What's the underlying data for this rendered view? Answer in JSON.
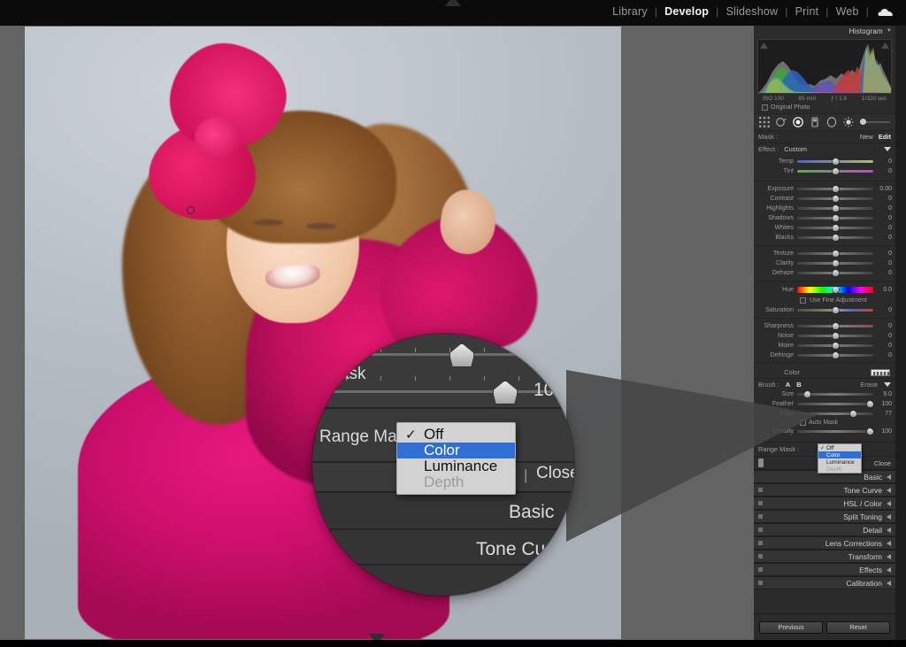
{
  "app": {
    "modules": [
      {
        "label": "Library",
        "active": false
      },
      {
        "label": "Develop",
        "active": true
      },
      {
        "label": "Slideshow",
        "active": false
      },
      {
        "label": "Print",
        "active": false
      },
      {
        "label": "Web",
        "active": false
      }
    ],
    "separator": "|",
    "cloud_icon": "cloud-icon"
  },
  "histogram": {
    "title": "Histogram",
    "iso": "ISO 100",
    "focal": "85 mm",
    "aperture": "ƒ / 1.6",
    "shutter": "1/320 sec",
    "original_photo_label": "Original Photo"
  },
  "toolstrip": {
    "icons": [
      "grid-crop-icon",
      "spot-removal-icon",
      "red-eye-icon",
      "graduated-filter-icon",
      "radial-filter-icon",
      "brush-icon"
    ],
    "brightness_icon": "brightness-icon"
  },
  "mask_bar": {
    "label": "Mask :",
    "new_label": "New",
    "edit_label": "Edit"
  },
  "effect_bar": {
    "label": "Effect :",
    "value": "Custom",
    "flip_icon": "flip-triangle-icon"
  },
  "sliders": {
    "white_balance": [
      {
        "label": "Temp",
        "value": "0",
        "pos": 50,
        "style": "temp"
      },
      {
        "label": "Tint",
        "value": "0",
        "pos": 50,
        "style": "tint"
      }
    ],
    "tone": [
      {
        "label": "Exposure",
        "value": "0.00",
        "pos": 50,
        "style": "plain"
      },
      {
        "label": "Contrast",
        "value": "0",
        "pos": 50,
        "style": "plain"
      },
      {
        "label": "Highlights",
        "value": "0",
        "pos": 50,
        "style": "plain"
      },
      {
        "label": "Shadows",
        "value": "0",
        "pos": 50,
        "style": "plain"
      },
      {
        "label": "Whites",
        "value": "0",
        "pos": 50,
        "style": "plain"
      },
      {
        "label": "Blacks",
        "value": "0",
        "pos": 50,
        "style": "plain"
      }
    ],
    "presence": [
      {
        "label": "Texture",
        "value": "0",
        "pos": 50,
        "style": "plain"
      },
      {
        "label": "Clarity",
        "value": "0",
        "pos": 50,
        "style": "plain"
      },
      {
        "label": "Dehaze",
        "value": "0",
        "pos": 50,
        "style": "plain"
      }
    ],
    "color": [
      {
        "label": "Hue",
        "value": "0.0",
        "pos": 50,
        "style": "hue"
      }
    ],
    "fine_adjustment_label": "Use Fine Adjustment",
    "saturation": [
      {
        "label": "Saturation",
        "value": "0",
        "pos": 50,
        "style": "sat"
      }
    ],
    "detail": [
      {
        "label": "Sharpness",
        "value": "0",
        "pos": 50,
        "style": "sharp"
      },
      {
        "label": "Noise",
        "value": "0",
        "pos": 50,
        "style": "plain"
      },
      {
        "label": "Moire",
        "value": "0",
        "pos": 50,
        "style": "plain"
      },
      {
        "label": "Defringe",
        "value": "0",
        "pos": 50,
        "style": "plain"
      }
    ],
    "color_row_label": "Color"
  },
  "brush": {
    "label": "Brush :",
    "a_label": "A",
    "b_label": "B",
    "erase_label": "Erase",
    "sliders": [
      {
        "label": "Size",
        "value": "9.0",
        "pos": 13,
        "style": "plain"
      },
      {
        "label": "Feather",
        "value": "100",
        "pos": 95,
        "style": "plain"
      },
      {
        "label": "Flow",
        "value": "77",
        "pos": 73,
        "style": "plain"
      },
      {
        "label": "Density",
        "value": "100",
        "pos": 95,
        "style": "plain"
      }
    ],
    "auto_mask_label": "Auto Mask"
  },
  "range_mask": {
    "label": "Range Mask :",
    "options": [
      {
        "label": "Off",
        "state": "checked"
      },
      {
        "label": "Color",
        "state": "selected"
      },
      {
        "label": "Luminance",
        "state": "normal"
      },
      {
        "label": "Depth",
        "state": "disabled"
      }
    ],
    "checkmark": "✓"
  },
  "panel_footer": {
    "pin_icon": "pin-icon",
    "close_label": "Close"
  },
  "sections": [
    {
      "label": "Basic",
      "has_switch": false
    },
    {
      "label": "Tone Curve",
      "has_switch": true
    },
    {
      "label": "HSL / Color",
      "has_switch": true
    },
    {
      "label": "Split Toning",
      "has_switch": true
    },
    {
      "label": "Detail",
      "has_switch": true
    },
    {
      "label": "Lens Corrections",
      "has_switch": true
    },
    {
      "label": "Transform",
      "has_switch": true
    },
    {
      "label": "Effects",
      "has_switch": true
    },
    {
      "label": "Calibration",
      "has_switch": true
    }
  ],
  "panel_buttons": {
    "previous": "Previous",
    "reset": "Reset"
  },
  "loupe": {
    "auto_mask_label": "to Mask",
    "density_value": "10",
    "range_mask_label": "Range Mask",
    "close_label": "Close",
    "divider": "|",
    "basic_label": "Basic",
    "tone_curve_label": "Tone Cu",
    "menu": [
      {
        "label": "Off",
        "state": "checked"
      },
      {
        "label": "Color",
        "state": "selected"
      },
      {
        "label": "Luminance",
        "state": "normal"
      },
      {
        "label": "Depth",
        "state": "disabled"
      }
    ],
    "checkmark": "✓"
  },
  "colors": {
    "accent_blue": "#2f6fd6",
    "panel_bg": "#2b2b2b",
    "workarea_bg": "#636363",
    "menu_bg": "#d2d2d2",
    "sweater_pink": "#d1106e"
  }
}
